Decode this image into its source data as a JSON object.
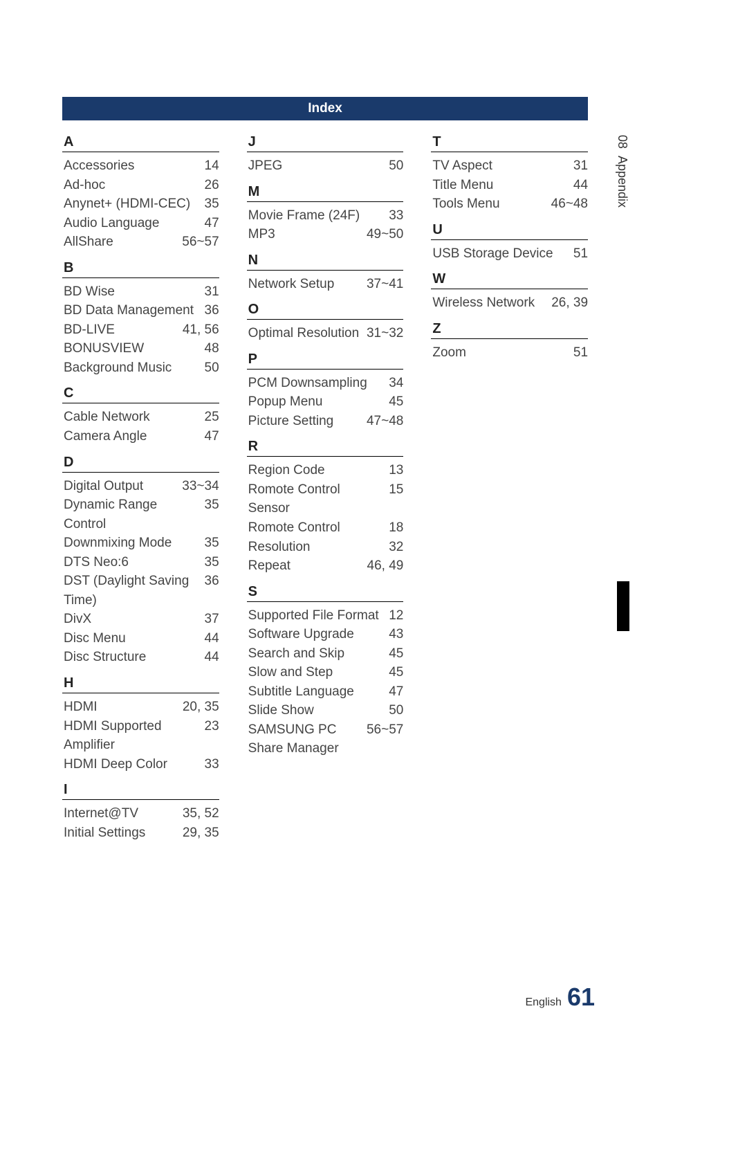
{
  "header": {
    "title": "Index"
  },
  "side": {
    "num": "08",
    "label": "Appendix"
  },
  "footer": {
    "lang": "English",
    "page": "61"
  },
  "columns": [
    {
      "sections": [
        {
          "letter": "A",
          "entries": [
            {
              "term": "Accessories",
              "page": "14"
            },
            {
              "term": "Ad-hoc",
              "page": "26"
            },
            {
              "term": "Anynet+ (HDMI-CEC)",
              "page": "35"
            },
            {
              "term": "Audio Language",
              "page": "47"
            },
            {
              "term": "AllShare",
              "page": "56~57"
            }
          ]
        },
        {
          "letter": "B",
          "entries": [
            {
              "term": "BD Wise",
              "page": "31"
            },
            {
              "term": "BD Data Management",
              "page": "36"
            },
            {
              "term": "BD-LIVE",
              "page": "41, 56"
            },
            {
              "term": "BONUSVIEW",
              "page": "48"
            },
            {
              "term": "Background Music",
              "page": "50"
            }
          ]
        },
        {
          "letter": "C",
          "entries": [
            {
              "term": "Cable Network",
              "page": "25"
            },
            {
              "term": "Camera Angle",
              "page": "47"
            }
          ]
        },
        {
          "letter": "D",
          "entries": [
            {
              "term": "Digital Output",
              "page": "33~34"
            },
            {
              "term": "Dynamic Range Control",
              "page": "35"
            },
            {
              "term": "Downmixing Mode",
              "page": "35"
            },
            {
              "term": "DTS Neo:6",
              "page": "35"
            },
            {
              "term": "DST (Daylight Saving Time)",
              "page": "36"
            },
            {
              "term": "DivX",
              "page": "37"
            },
            {
              "term": "Disc Menu",
              "page": "44"
            },
            {
              "term": "Disc Structure",
              "page": "44"
            }
          ]
        },
        {
          "letter": "H",
          "entries": [
            {
              "term": "HDMI",
              "page": "20, 35"
            },
            {
              "term": "HDMI Supported Amplifier",
              "page": "23"
            },
            {
              "term": "HDMI Deep Color",
              "page": "33"
            }
          ]
        },
        {
          "letter": "I",
          "entries": [
            {
              "term": "Internet@TV",
              "page": "35, 52"
            },
            {
              "term": "Initial Settings",
              "page": "29, 35"
            }
          ]
        }
      ]
    },
    {
      "sections": [
        {
          "letter": "J",
          "entries": [
            {
              "term": "JPEG",
              "page": "50"
            }
          ]
        },
        {
          "letter": "M",
          "entries": [
            {
              "term": "Movie Frame (24F)",
              "page": "33"
            },
            {
              "term": "MP3",
              "page": "49~50"
            }
          ]
        },
        {
          "letter": "N",
          "entries": [
            {
              "term": "Network Setup",
              "page": "37~41"
            }
          ]
        },
        {
          "letter": "O",
          "entries": [
            {
              "term": "Optimal Resolution",
              "page": "31~32"
            }
          ]
        },
        {
          "letter": "P",
          "entries": [
            {
              "term": "PCM Downsampling",
              "page": "34"
            },
            {
              "term": "Popup Menu",
              "page": "45"
            },
            {
              "term": "Picture Setting",
              "page": "47~48"
            }
          ]
        },
        {
          "letter": "R",
          "entries": [
            {
              "term": "Region Code",
              "page": "13"
            },
            {
              "term": "Romote Control Sensor",
              "page": "15"
            },
            {
              "term": "Romote Control",
              "page": "18"
            },
            {
              "term": "Resolution",
              "page": "32"
            },
            {
              "term": "Repeat",
              "page": "46, 49"
            }
          ]
        },
        {
          "letter": "S",
          "entries": [
            {
              "term": "Supported File Format",
              "page": "12"
            },
            {
              "term": "Software Upgrade",
              "page": "43"
            },
            {
              "term": "Search and Skip",
              "page": "45"
            },
            {
              "term": "Slow and Step",
              "page": "45"
            },
            {
              "term": "Subtitle Language",
              "page": "47"
            },
            {
              "term": "Slide Show",
              "page": "50"
            },
            {
              "term": "SAMSUNG PC Share Manager",
              "page": "56~57"
            }
          ]
        }
      ]
    },
    {
      "sections": [
        {
          "letter": "T",
          "entries": [
            {
              "term": "TV Aspect",
              "page": "31"
            },
            {
              "term": "Title Menu",
              "page": "44"
            },
            {
              "term": "Tools Menu",
              "page": "46~48"
            }
          ]
        },
        {
          "letter": "U",
          "entries": [
            {
              "term": "USB Storage Device",
              "page": "51"
            }
          ]
        },
        {
          "letter": "W",
          "entries": [
            {
              "term": "Wireless Network",
              "page": "26, 39"
            }
          ]
        },
        {
          "letter": "Z",
          "entries": [
            {
              "term": "Zoom",
              "page": "51"
            }
          ]
        }
      ]
    }
  ]
}
